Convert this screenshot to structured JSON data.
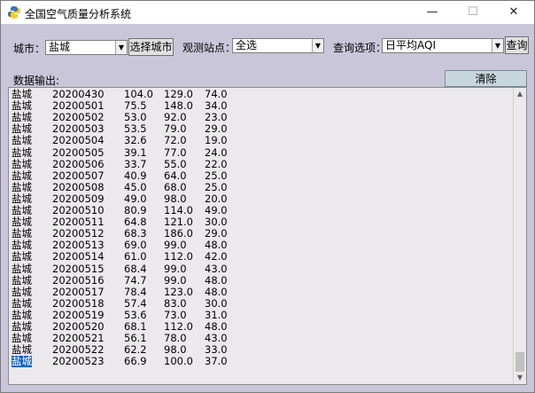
{
  "window": {
    "title": "全国空气质量分析系统",
    "minimize": "—",
    "maximize": "☐",
    "close": "✕"
  },
  "controls": {
    "city_label": "城市：",
    "city_value": "盐城",
    "select_city_button": "选择城市",
    "station_label": "观测站点：",
    "station_value": "全选",
    "query_label": "查询选项：",
    "query_value": "日平均AQI",
    "query_button": "查询",
    "output_label": "数据输出:",
    "clear_button": "清除"
  },
  "output": {
    "rows": [
      [
        "盐城",
        "20200430",
        "104.0",
        "129.0",
        "74.0"
      ],
      [
        "盐城",
        "20200501",
        "75.5",
        "148.0",
        "34.0"
      ],
      [
        "盐城",
        "20200502",
        "53.0",
        "92.0",
        "23.0"
      ],
      [
        "盐城",
        "20200503",
        "53.5",
        "79.0",
        "29.0"
      ],
      [
        "盐城",
        "20200504",
        "32.6",
        "72.0",
        "19.0"
      ],
      [
        "盐城",
        "20200505",
        "39.1",
        "77.0",
        "24.0"
      ],
      [
        "盐城",
        "20200506",
        "33.7",
        "55.0",
        "22.0"
      ],
      [
        "盐城",
        "20200507",
        "40.9",
        "64.0",
        "25.0"
      ],
      [
        "盐城",
        "20200508",
        "45.0",
        "68.0",
        "25.0"
      ],
      [
        "盐城",
        "20200509",
        "49.0",
        "98.0",
        "20.0"
      ],
      [
        "盐城",
        "20200510",
        "80.9",
        "114.0",
        "49.0"
      ],
      [
        "盐城",
        "20200511",
        "64.8",
        "121.0",
        "30.0"
      ],
      [
        "盐城",
        "20200512",
        "68.3",
        "186.0",
        "29.0"
      ],
      [
        "盐城",
        "20200513",
        "69.0",
        "99.0",
        "48.0"
      ],
      [
        "盐城",
        "20200514",
        "61.0",
        "112.0",
        "42.0"
      ],
      [
        "盐城",
        "20200515",
        "68.4",
        "99.0",
        "43.0"
      ],
      [
        "盐城",
        "20200516",
        "74.7",
        "99.0",
        "48.0"
      ],
      [
        "盐城",
        "20200517",
        "78.4",
        "123.0",
        "48.0"
      ],
      [
        "盐城",
        "20200518",
        "57.4",
        "83.0",
        "30.0"
      ],
      [
        "盐城",
        "20200519",
        "53.6",
        "73.0",
        "31.0"
      ],
      [
        "盐城",
        "20200520",
        "68.1",
        "112.0",
        "48.0"
      ],
      [
        "盐城",
        "20200521",
        "56.1",
        "78.0",
        "43.0"
      ],
      [
        "盐城",
        "20200522",
        "62.2",
        "98.0",
        "33.0"
      ],
      [
        "盐城",
        "20200523",
        "66.9",
        "100.0",
        "37.0"
      ]
    ],
    "selected_row": 23
  },
  "icons": {
    "app": "python-icon",
    "combo_arrow": "▼",
    "scroll_up": "▲",
    "scroll_down": "▼"
  }
}
